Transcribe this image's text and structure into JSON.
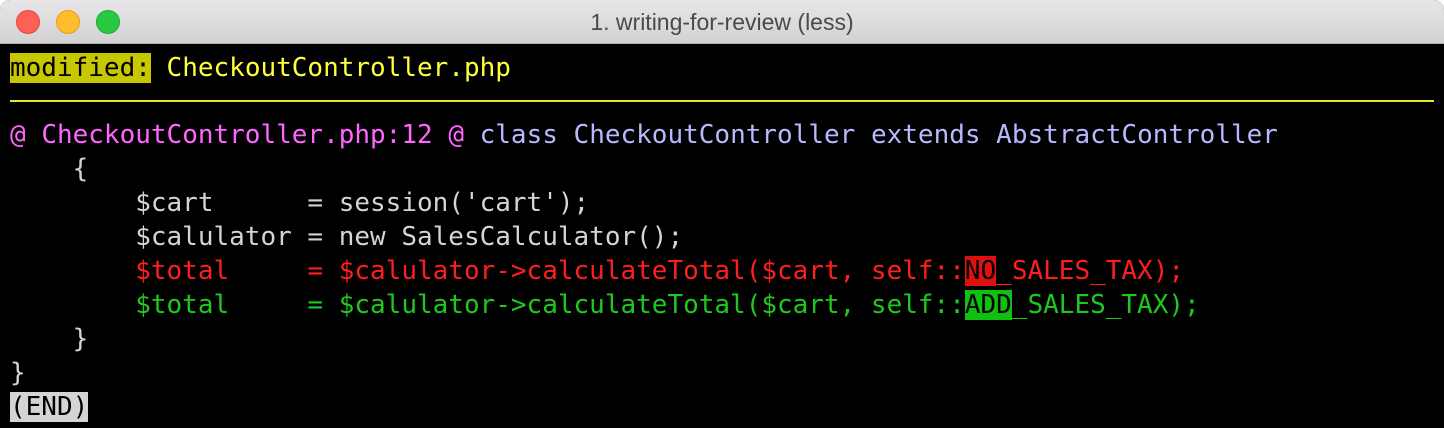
{
  "window": {
    "title": "1. writing-for-review (less)"
  },
  "header": {
    "status": "modified:",
    "file": "CheckoutController.php"
  },
  "hunk": {
    "at_open": "@",
    "location": "CheckoutController.php:12",
    "at_close": "@",
    "context": "class CheckoutController extends AbstractController"
  },
  "code": {
    "open_brace": "    {",
    "line_cart": "        $cart      = session('cart');",
    "line_calculator": "        $calulator = new SalesCalculator();",
    "removed_prefix": "        $total     = $calulator->calculateTotal($cart, self::",
    "removed_highlight": "NO",
    "removed_suffix": "_SALES_TAX);",
    "added_prefix": "        $total     = $calulator->calculateTotal($cart, self::",
    "added_highlight": "ADD",
    "added_suffix": "_SALES_TAX);",
    "close_inner_brace": "    }",
    "close_outer_brace": "}"
  },
  "pager": {
    "end_marker": "(END)"
  },
  "colors": {
    "modified_badge": "#c8c800",
    "filename": "#ffff3c",
    "hunk_header": "#ff66ff",
    "hunk_context": "#b8b8ff",
    "removed": "#ff1e1e",
    "added": "#1ec81e"
  }
}
